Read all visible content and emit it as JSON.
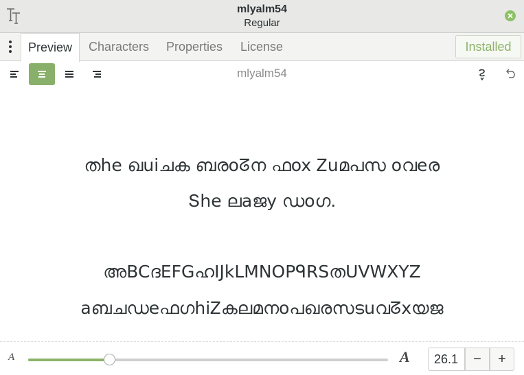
{
  "window": {
    "title": "mlyalm54",
    "subtitle": "Regular",
    "app_icon": "font-viewer-icon",
    "close_icon": "close-icon",
    "accent_color": "#8cb369"
  },
  "tabs": [
    {
      "label": "Preview",
      "active": true
    },
    {
      "label": "Characters",
      "active": false
    },
    {
      "label": "Properties",
      "active": false
    },
    {
      "label": "License",
      "active": false
    }
  ],
  "install_button": {
    "label": "Installed"
  },
  "toolbar": {
    "title": "mlyalm54",
    "align_buttons": [
      {
        "name": "align-left",
        "active": false
      },
      {
        "name": "align-center",
        "active": true
      },
      {
        "name": "align-justify",
        "active": false
      },
      {
        "name": "align-right",
        "active": false
      }
    ]
  },
  "preview": {
    "lines": [
      "തhe ഖuiചക ബരoᘔന ഫox Ꮓuമപസ oവeര",
      "Տhe ലaജy ഡoഗ.",
      "",
      "അBCദEFGഹIJkLMNOPᑫRSതUVWXYZ",
      "aബചഡeഫഗhiᏃകലമനoപഖരസടuവᘔxയജ"
    ]
  },
  "size_control": {
    "value": "26.1",
    "slider_fraction": 0.225,
    "decrease_label": "−",
    "increase_label": "+"
  }
}
